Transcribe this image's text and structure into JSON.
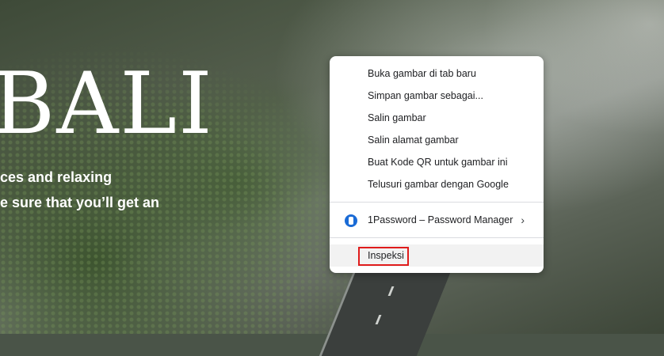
{
  "hero": {
    "title": "BALI",
    "line1": "ces and relaxing",
    "line2": "e sure that you’ll get an"
  },
  "context_menu": {
    "items": [
      {
        "label": "Buka gambar di tab baru"
      },
      {
        "label": "Simpan gambar sebagai..."
      },
      {
        "label": "Salin gambar"
      },
      {
        "label": "Salin alamat gambar"
      },
      {
        "label": "Buat Kode QR untuk gambar ini"
      },
      {
        "label": "Telusuri gambar dengan Google"
      }
    ],
    "extension": {
      "label": "1Password – Password Manager",
      "icon": "1password-icon",
      "submenu_icon": "chevron-right-icon"
    },
    "inspect": {
      "label": "Inspeksi",
      "highlighted": true
    }
  },
  "colors": {
    "annotation_box": "#e01c1c",
    "menu_background": "#ffffff",
    "hover_background": "#f2f2f2"
  }
}
